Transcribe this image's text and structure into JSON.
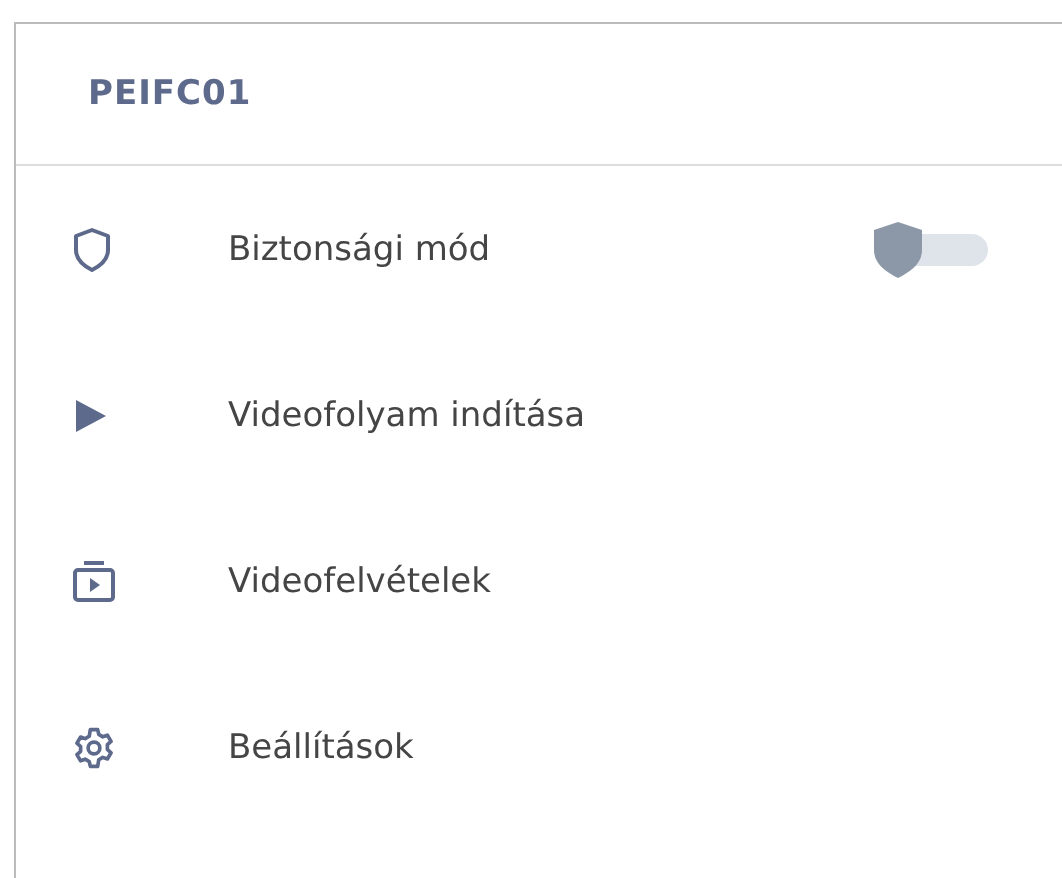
{
  "header": {
    "title": "PEIFC01"
  },
  "menu": [
    {
      "kind": "toggle",
      "label": "Biztonsági mód",
      "on": false
    },
    {
      "kind": "link",
      "label": "Videofolyam indítása"
    },
    {
      "kind": "link",
      "label": "Videofelvételek"
    },
    {
      "kind": "link",
      "label": "Beállítások"
    }
  ]
}
